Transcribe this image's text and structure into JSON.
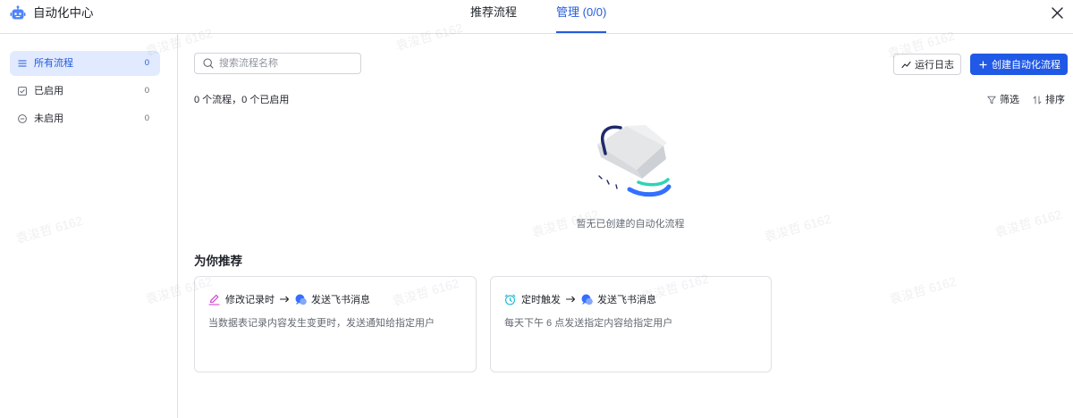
{
  "header": {
    "title": "自动化中心",
    "app_icon": "robot-icon",
    "tabs": [
      {
        "label": "推荐流程",
        "active": false
      },
      {
        "label": "管理 (0/0)",
        "active": true
      }
    ],
    "close_icon": "close-icon"
  },
  "sidebar": {
    "items": [
      {
        "label": "所有流程",
        "count": "0",
        "icon": "list-icon",
        "selected": true
      },
      {
        "label": "已启用",
        "count": "0",
        "icon": "checkbox-checked-icon",
        "selected": false
      },
      {
        "label": "未启用",
        "count": "0",
        "icon": "minus-circle-icon",
        "selected": false
      }
    ]
  },
  "toolbar": {
    "search": {
      "placeholder": "搜索流程名称",
      "value": "",
      "icon": "search-icon"
    },
    "run_log": {
      "label": "运行日志",
      "icon": "trend-icon"
    },
    "create": {
      "label": "创建自动化流程",
      "icon": "plus-icon"
    }
  },
  "list": {
    "summary": "0 个流程，0 个已启用",
    "filter": {
      "label": "筛选",
      "icon": "filter-icon"
    },
    "sort": {
      "label": "排序",
      "icon": "sort-icon"
    },
    "empty": {
      "message": "暂无已创建的自动化流程"
    }
  },
  "recommend": {
    "heading": "为你推荐",
    "cards": [
      {
        "trigger": {
          "label": "修改记录时",
          "icon": "edit-icon"
        },
        "arrow_icon": "arrow-right-icon",
        "action": {
          "label": "发送飞书消息",
          "icon": "message-icon"
        },
        "description": "当数据表记录内容发生变更时，发送通知给指定用户"
      },
      {
        "trigger": {
          "label": "定时触发",
          "icon": "alarm-clock-icon"
        },
        "arrow_icon": "arrow-right-icon",
        "action": {
          "label": "发送飞书消息",
          "icon": "message-icon"
        },
        "description": "每天下午 6 点发送指定内容给指定用户"
      }
    ]
  },
  "watermark": "袁浚哲 6162",
  "colors": {
    "accent": "#245bdb",
    "primary_button": "#2059e6",
    "selected_bg": "#e1eaff",
    "text": "#1f2329",
    "text_secondary": "#646a73",
    "border": "#dee0e3",
    "edit_icon": "#d136d1",
    "alarm_icon": "#16b5cf",
    "message_icon": "#3370ff",
    "message_icon_light": "#82a7fc",
    "robot_icon": "#4e83fd"
  }
}
